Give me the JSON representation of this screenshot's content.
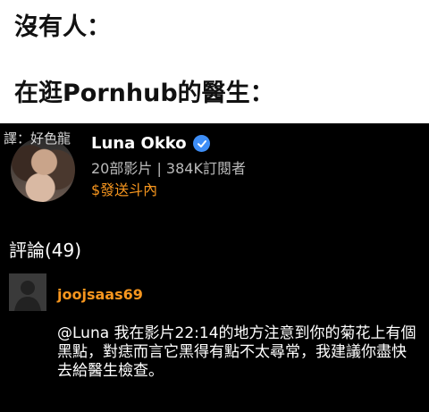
{
  "meme": {
    "line1": "沒有人：",
    "line2": "在逛Pornhub的醫生："
  },
  "translator_credit": "譯：好色龍",
  "channel": {
    "name": "Luna Okko",
    "stats": "20部影片 | 384K訂閱者",
    "tip": "$發送斗內"
  },
  "comments": {
    "header": "評論(49)",
    "items": [
      {
        "user": "joojsaas69",
        "text": "@Luna 我在影片22:14的地方注意到你的菊花上有個黑點，對痣而言它黑得有點不太尋常，我建議你盡快去給醫生檢查。"
      }
    ]
  },
  "colors": {
    "accent": "#f7961e",
    "verified": "#3e8ef7",
    "panel_bg": "#000000"
  },
  "icons": [
    "verified-check-icon",
    "default-avatar-icon"
  ]
}
